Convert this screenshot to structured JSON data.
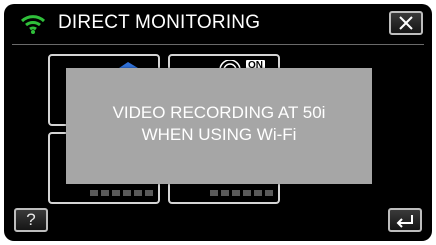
{
  "header": {
    "title": "DIRECT MONITORING",
    "wifi_icon": "wifi-icon",
    "close_icon": "close-icon"
  },
  "thumbnail": {
    "badge": "ON"
  },
  "message": {
    "line1": "VIDEO RECORDING AT 50i",
    "line2": "WHEN USING Wi-Fi"
  },
  "footer": {
    "help_label": "?",
    "back_icon": "back-arrow-icon"
  },
  "colors": {
    "background": "#000000",
    "wifi": "#2fbf3a",
    "overlay": "#a6a6a6",
    "accent_blue": "#2f6fd6"
  }
}
